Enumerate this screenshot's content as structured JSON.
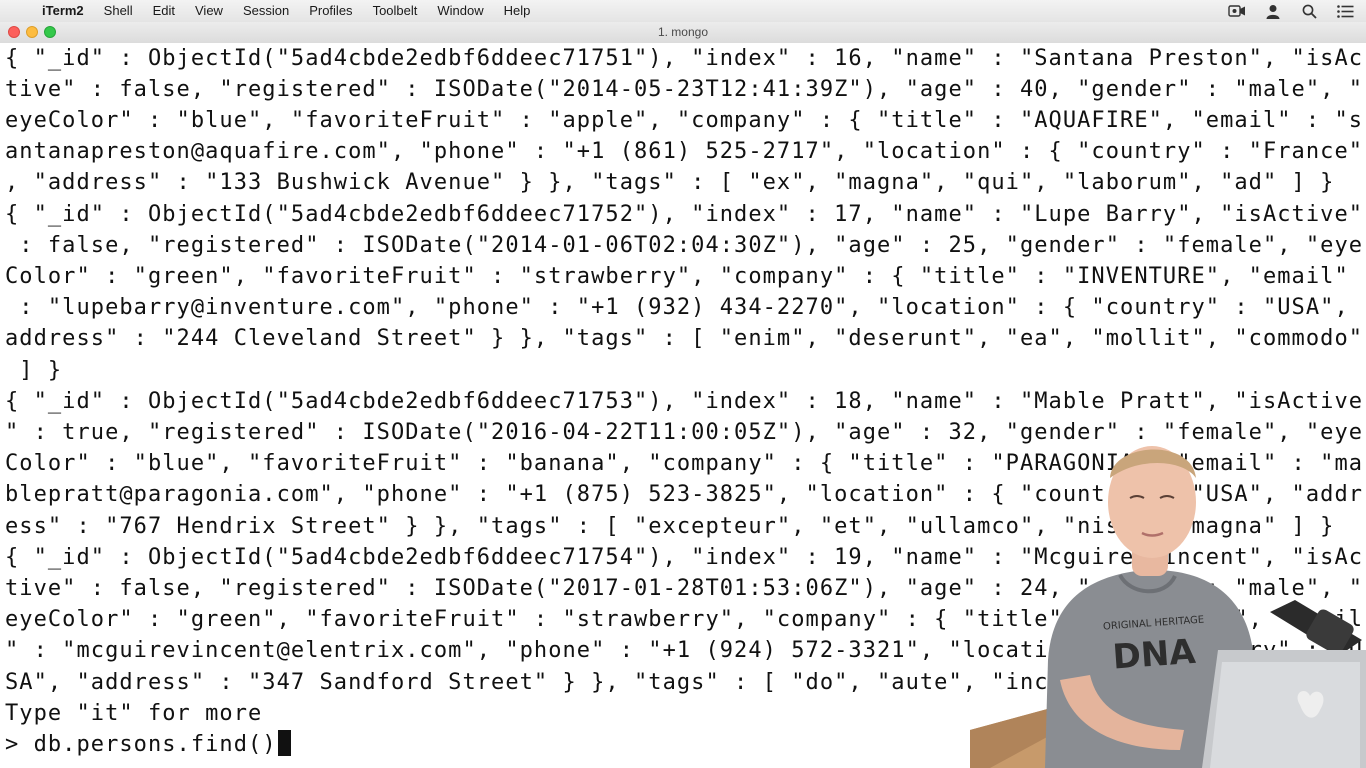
{
  "menubar": {
    "apple_glyph": "",
    "app_name": "iTerm2",
    "items": [
      "Shell",
      "Edit",
      "View",
      "Session",
      "Profiles",
      "Toolbelt",
      "Window",
      "Help"
    ],
    "right_icons": [
      "camera-icon",
      "user-icon",
      "search-icon",
      "list-icon"
    ]
  },
  "window": {
    "title": "1. mongo"
  },
  "terminal": {
    "lines": [
      "{ \"_id\" : ObjectId(\"5ad4cbde2edbf6ddeec71751\"), \"index\" : 16, \"name\" : \"Santana Preston\", \"isAc",
      "tive\" : false, \"registered\" : ISODate(\"2014-05-23T12:41:39Z\"), \"age\" : 40, \"gender\" : \"male\", \"",
      "eyeColor\" : \"blue\", \"favoriteFruit\" : \"apple\", \"company\" : { \"title\" : \"AQUAFIRE\", \"email\" : \"s",
      "antanapreston@aquafire.com\", \"phone\" : \"+1 (861) 525-2717\", \"location\" : { \"country\" : \"France\"",
      ", \"address\" : \"133 Bushwick Avenue\" } }, \"tags\" : [ \"ex\", \"magna\", \"qui\", \"laborum\", \"ad\" ] }",
      "{ \"_id\" : ObjectId(\"5ad4cbde2edbf6ddeec71752\"), \"index\" : 17, \"name\" : \"Lupe Barry\", \"isActive\"",
      " : false, \"registered\" : ISODate(\"2014-01-06T02:04:30Z\"), \"age\" : 25, \"gender\" : \"female\", \"eye",
      "Color\" : \"green\", \"favoriteFruit\" : \"strawberry\", \"company\" : { \"title\" : \"INVENTURE\", \"email\"",
      " : \"lupebarry@inventure.com\", \"phone\" : \"+1 (932) 434-2270\", \"location\" : { \"country\" : \"USA\", \"",
      "address\" : \"244 Cleveland Street\" } }, \"tags\" : [ \"enim\", \"deserunt\", \"ea\", \"mollit\", \"commodo\"",
      " ] }",
      "{ \"_id\" : ObjectId(\"5ad4cbde2edbf6ddeec71753\"), \"index\" : 18, \"name\" : \"Mable Pratt\", \"isActive",
      "\" : true, \"registered\" : ISODate(\"2016-04-22T11:00:05Z\"), \"age\" : 32, \"gender\" : \"female\", \"eye",
      "Color\" : \"blue\", \"favoriteFruit\" : \"banana\", \"company\" : { \"title\" : \"PARAGONIA\", \"email\" : \"ma",
      "blepratt@paragonia.com\", \"phone\" : \"+1 (875) 523-3825\", \"location\" : { \"country\" : \"USA\", \"addr",
      "ess\" : \"767 Hendrix Street\" } }, \"tags\" : [ \"excepteur\", \"et\", \"ullamco\", \"nisi\", \"magna\" ] }",
      "{ \"_id\" : ObjectId(\"5ad4cbde2edbf6ddeec71754\"), \"index\" : 19, \"name\" : \"Mcguire Vincent\", \"isAc",
      "tive\" : false, \"registered\" : ISODate(\"2017-01-28T01:53:06Z\"), \"age\" : 24, \"gender\" : \"male\", \"",
      "eyeColor\" : \"green\", \"favoriteFruit\" : \"strawberry\", \"company\" : { \"title\" : \"ELENTRIX\", \"email",
      "\" : \"mcguirevincent@elentrix.com\", \"phone\" : \"+1 (924) 572-3321\", \"location\" : { \"country\" : \"U",
      "SA\", \"address\" : \"347 Sandford Street\" } }, \"tags\" : [ \"do\", \"aute\", \"incididunt\" ] }",
      "Type \"it\" for more"
    ],
    "prompt": "> ",
    "command": "db.persons.find()"
  },
  "presenter_shirt_text": [
    "ORIGINAL HERITAGE",
    "DNA"
  ],
  "colors": {
    "terminal_bg": "#ffffff",
    "terminal_fg": "#111111",
    "close": "#fc605c",
    "minimize": "#fdbc40",
    "maximize": "#34c84a"
  }
}
